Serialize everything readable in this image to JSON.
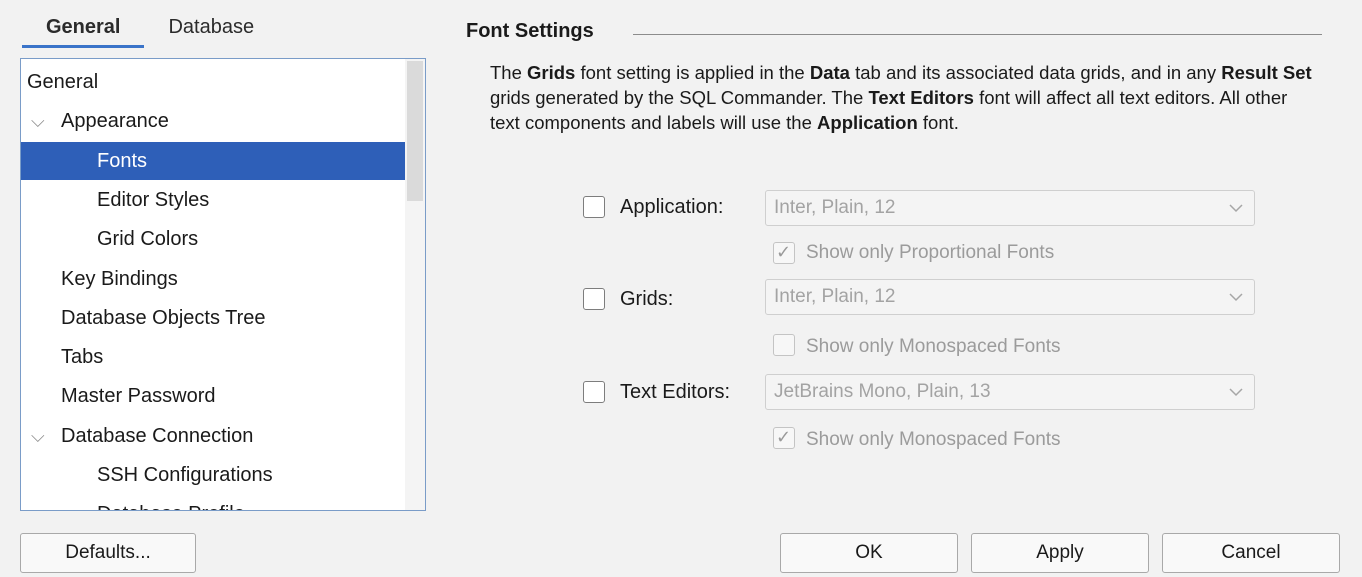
{
  "tabs": [
    {
      "label": "General",
      "active": true
    },
    {
      "label": "Database",
      "active": false
    }
  ],
  "tree": {
    "items": [
      {
        "label": "General",
        "level": 0,
        "expandable": false,
        "selected": false
      },
      {
        "label": "Appearance",
        "level": 1,
        "expandable": true,
        "selected": false
      },
      {
        "label": "Fonts",
        "level": 2,
        "expandable": false,
        "selected": true
      },
      {
        "label": "Editor Styles",
        "level": 2,
        "expandable": false,
        "selected": false
      },
      {
        "label": "Grid Colors",
        "level": 2,
        "expandable": false,
        "selected": false
      },
      {
        "label": "Key Bindings",
        "level": 1,
        "expandable": false,
        "selected": false
      },
      {
        "label": "Database Objects Tree",
        "level": 1,
        "expandable": false,
        "selected": false
      },
      {
        "label": "Tabs",
        "level": 1,
        "expandable": false,
        "selected": false
      },
      {
        "label": "Master Password",
        "level": 1,
        "expandable": false,
        "selected": false
      },
      {
        "label": "Database Connection",
        "level": 1,
        "expandable": true,
        "selected": false
      },
      {
        "label": "SSH Configurations",
        "level": 2,
        "expandable": false,
        "selected": false
      },
      {
        "label": "Database Profile",
        "level": 2,
        "expandable": false,
        "selected": false
      }
    ],
    "chevron_icon": "chevron-down-icon"
  },
  "font_settings": {
    "title": "Font Settings",
    "description": {
      "p1": "The ",
      "b1": "Grids",
      "p2": " font setting is applied in the ",
      "b2": "Data",
      "p3": " tab and its associated data grids, and in any ",
      "b3": "Result Set",
      "p4": " grids generated by the SQL Commander. The ",
      "b4": "Text Editors",
      "p5": " font will affect all text editors. All other text components and labels will use the ",
      "b5": "Application",
      "p6": " font."
    },
    "rows": [
      {
        "label": "Application:",
        "checked": false,
        "value": "Inter, Plain, 12",
        "option_label": "Show only Proportional Fonts",
        "option_checked": true
      },
      {
        "label": "Grids:",
        "checked": false,
        "value": "Inter, Plain, 12",
        "option_label": "Show only Monospaced Fonts",
        "option_checked": false
      },
      {
        "label": "Text Editors:",
        "checked": false,
        "value": "JetBrains Mono, Plain, 13",
        "option_label": "Show only Monospaced Fonts",
        "option_checked": true
      }
    ]
  },
  "buttons": {
    "defaults": "Defaults...",
    "ok": "OK",
    "apply": "Apply",
    "cancel": "Cancel"
  },
  "colors": {
    "accent": "#2e5fb8",
    "tab_underline": "#3b74c9"
  }
}
